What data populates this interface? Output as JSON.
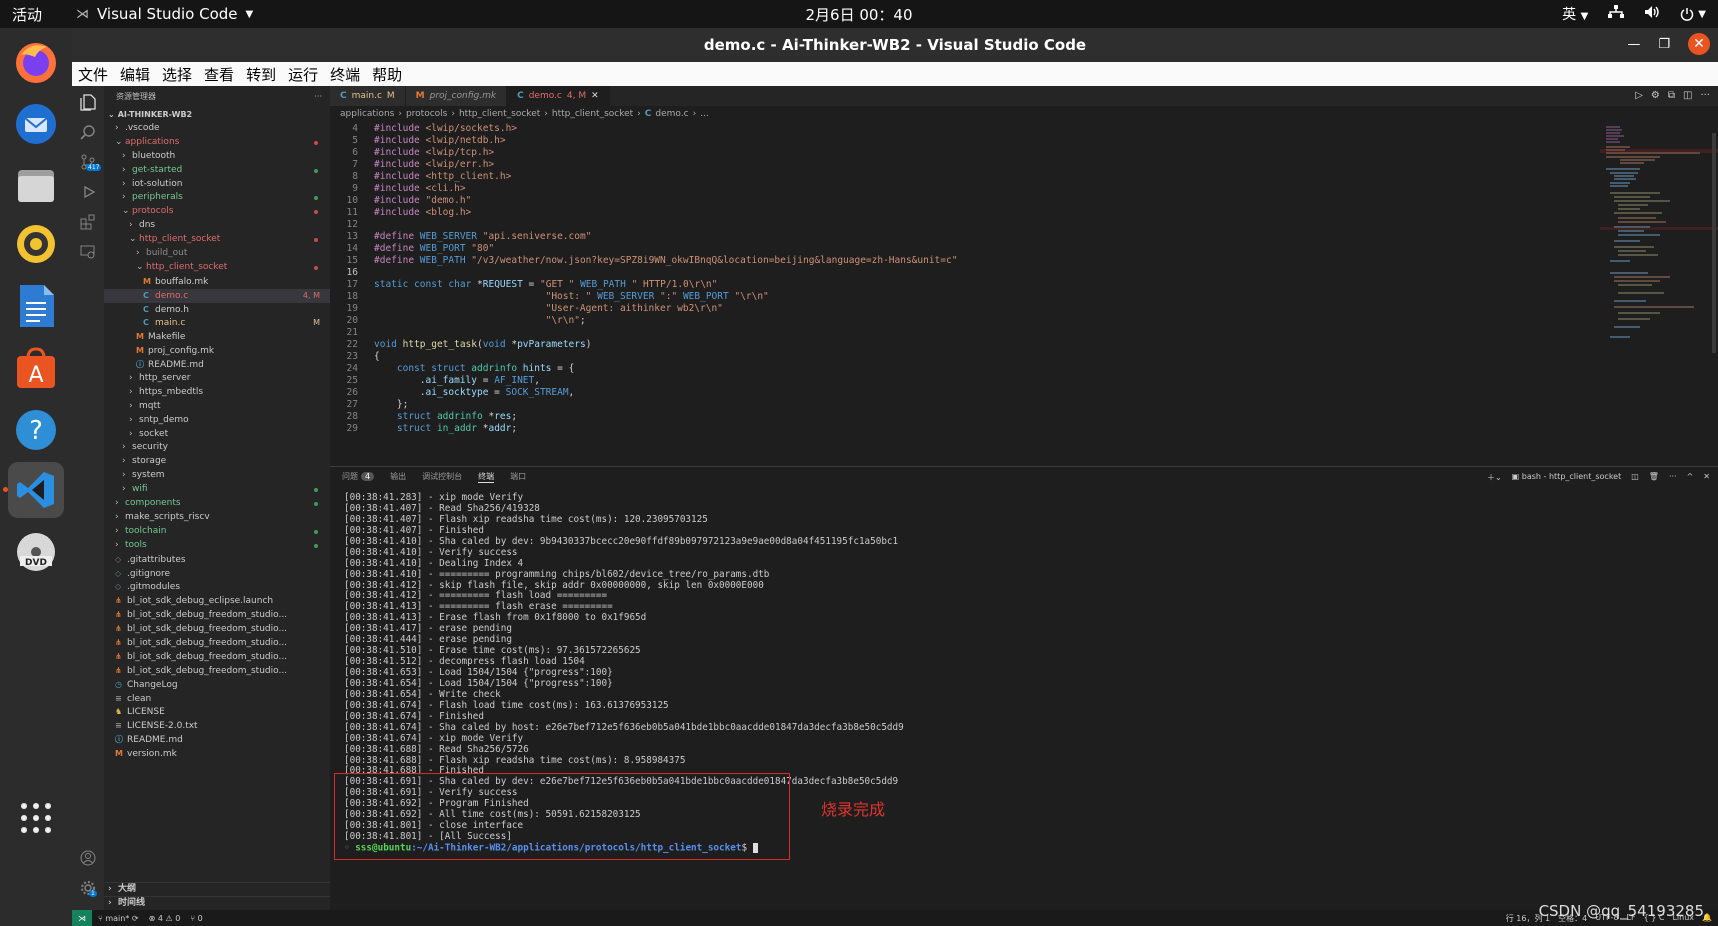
{
  "topbar": {
    "activities": "活动",
    "app_name": "Visual Studio Code",
    "clock": "2月6日  00：40",
    "ime": "英"
  },
  "window": {
    "title": "demo.c - Ai-Thinker-WB2 - Visual Studio Code"
  },
  "menu": [
    "文件",
    "编辑",
    "选择",
    "查看",
    "转到",
    "运行",
    "终端",
    "帮助"
  ],
  "dock": [
    "firefox-icon",
    "thunderbird-icon",
    "files-icon",
    "rhythmbox-icon",
    "writer-icon",
    "app-center-icon",
    "help-icon",
    "vscode-icon",
    "dvd-icon",
    "show-apps-icon"
  ],
  "activity_bar": {
    "scm_badge": "417",
    "settings_badge": "1"
  },
  "sidebar": {
    "header": "资源管理器",
    "root": "AI-THINKER-WB2",
    "tree": [
      {
        "d": 1,
        "k": "folder",
        "label": ".vscode",
        "open": false
      },
      {
        "d": 1,
        "k": "folder",
        "label": "applications",
        "open": true,
        "color": "#e06c6c",
        "dot": "#c74b4b"
      },
      {
        "d": 2,
        "k": "folder",
        "label": "bluetooth",
        "open": false
      },
      {
        "d": 2,
        "k": "folder",
        "label": "get-started",
        "open": false,
        "color": "#73c991",
        "dot": "#3f9b5a"
      },
      {
        "d": 2,
        "k": "folder",
        "label": "iot-solution",
        "open": false
      },
      {
        "d": 2,
        "k": "folder",
        "label": "peripherals",
        "open": false,
        "color": "#73c991",
        "dot": "#3f9b5a"
      },
      {
        "d": 2,
        "k": "folder",
        "label": "protocols",
        "open": true,
        "color": "#e06c6c",
        "dot": "#c74b4b"
      },
      {
        "d": 3,
        "k": "folder",
        "label": "dns",
        "open": false
      },
      {
        "d": 3,
        "k": "folder",
        "label": "http_client_socket",
        "open": true,
        "color": "#e06c6c",
        "dot": "#c74b4b"
      },
      {
        "d": 4,
        "k": "folder",
        "label": "build_out",
        "open": false,
        "color": "#8c8c8c"
      },
      {
        "d": 4,
        "k": "folder",
        "label": "http_client_socket",
        "open": true,
        "color": "#e06c6c",
        "dot": "#c74b4b"
      },
      {
        "d": 5,
        "k": "M",
        "label": "bouffalo.mk"
      },
      {
        "d": 5,
        "k": "C",
        "label": "demo.c",
        "color": "#e06c6c",
        "status": "4, M",
        "sel": true
      },
      {
        "d": 5,
        "k": "C",
        "label": "demo.h"
      },
      {
        "d": 5,
        "k": "C",
        "label": "main.c",
        "color": "#e2c08d",
        "status": "M"
      },
      {
        "d": 4,
        "k": "M",
        "label": "Makefile"
      },
      {
        "d": 4,
        "k": "M",
        "label": "proj_config.mk"
      },
      {
        "d": 4,
        "k": "i",
        "label": "README.md"
      },
      {
        "d": 3,
        "k": "folder",
        "label": "http_server",
        "open": false
      },
      {
        "d": 3,
        "k": "folder",
        "label": "https_mbedtls",
        "open": false
      },
      {
        "d": 3,
        "k": "folder",
        "label": "mqtt",
        "open": false
      },
      {
        "d": 3,
        "k": "folder",
        "label": "sntp_demo",
        "open": false
      },
      {
        "d": 3,
        "k": "folder",
        "label": "socket",
        "open": false
      },
      {
        "d": 2,
        "k": "folder",
        "label": "security",
        "open": false
      },
      {
        "d": 2,
        "k": "folder",
        "label": "storage",
        "open": false
      },
      {
        "d": 2,
        "k": "folder",
        "label": "system",
        "open": false
      },
      {
        "d": 2,
        "k": "folder",
        "label": "wifi",
        "open": false,
        "color": "#73c991",
        "dot": "#3f9b5a"
      },
      {
        "d": 1,
        "k": "folder",
        "label": "components",
        "open": false,
        "color": "#73c991",
        "dot": "#3f9b5a"
      },
      {
        "d": 1,
        "k": "folder",
        "label": "make_scripts_riscv",
        "open": false
      },
      {
        "d": 1,
        "k": "folder",
        "label": "toolchain",
        "open": false,
        "color": "#73c991",
        "dot": "#3f9b5a"
      },
      {
        "d": 1,
        "k": "folder",
        "label": "tools",
        "open": false,
        "color": "#73c991",
        "dot": "#3f9b5a"
      },
      {
        "d": 1,
        "k": "g",
        "label": ".gitattributes"
      },
      {
        "d": 1,
        "k": "g",
        "label": ".gitignore"
      },
      {
        "d": 1,
        "k": "g",
        "label": ".gitmodules"
      },
      {
        "d": 1,
        "k": "x",
        "label": "bl_iot_sdk_debug_eclipse.launch"
      },
      {
        "d": 1,
        "k": "x",
        "label": "bl_iot_sdk_debug_freedom_studio..."
      },
      {
        "d": 1,
        "k": "x",
        "label": "bl_iot_sdk_debug_freedom_studio..."
      },
      {
        "d": 1,
        "k": "x",
        "label": "bl_iot_sdk_debug_freedom_studio..."
      },
      {
        "d": 1,
        "k": "x",
        "label": "bl_iot_sdk_debug_freedom_studio..."
      },
      {
        "d": 1,
        "k": "x",
        "label": "bl_iot_sdk_debug_freedom_studio..."
      },
      {
        "d": 1,
        "k": "h",
        "label": "ChangeLog"
      },
      {
        "d": 1,
        "k": "e",
        "label": "clean"
      },
      {
        "d": 1,
        "k": "l",
        "label": "LICENSE"
      },
      {
        "d": 1,
        "k": "e",
        "label": "LICENSE-2.0.txt"
      },
      {
        "d": 1,
        "k": "i",
        "label": "README.md"
      },
      {
        "d": 1,
        "k": "M",
        "label": "version.mk"
      }
    ],
    "outline": "大纲",
    "timeline": "时间线"
  },
  "tabs": [
    {
      "label": "main.c",
      "flag": "M",
      "active": false,
      "italic": false
    },
    {
      "label": "proj_config.mk",
      "flag": "",
      "active": false,
      "italic": true
    },
    {
      "label": "demo.c",
      "flag": "4, M",
      "active": true,
      "italic": false
    }
  ],
  "breadcrumb": [
    "applications",
    "protocols",
    "http_client_socket",
    "http_client_socket",
    "demo.c",
    "..."
  ],
  "code_lines": [
    {
      "n": "4",
      "html": "<span class='pp'>#include</span> <span class='str'>&lt;lwip/sockets.h&gt;</span>"
    },
    {
      "n": "5",
      "html": "<span class='pp'>#include</span> <span class='str'>&lt;lwip/netdb.h&gt;</span>"
    },
    {
      "n": "6",
      "html": "<span class='pp'>#include</span> <span class='str'>&lt;lwip/tcp.h&gt;</span>"
    },
    {
      "n": "7",
      "html": "<span class='pp'>#include</span> <span class='str'>&lt;lwip/err.h&gt;</span>"
    },
    {
      "n": "8",
      "html": "<span class='pp'>#include</span> <span class='str'>&lt;http_client.h&gt;</span>"
    },
    {
      "n": "9",
      "html": "<span class='pp'>#include</span> <span class='str'>&lt;cli.h&gt;</span>"
    },
    {
      "n": "10",
      "html": "<span class='pp'>#include</span> <span class='str'>\"demo.h\"</span>"
    },
    {
      "n": "11",
      "html": "<span class='pp'>#include</span> <span class='str'>&lt;blog.h&gt;</span>"
    },
    {
      "n": "12",
      "html": ""
    },
    {
      "n": "13",
      "html": "<span class='pp'>#define</span> <span class='mac'>WEB_SERVER</span> <span class='str'>\"api.seniverse.com\"</span>"
    },
    {
      "n": "14",
      "html": "<span class='pp'>#define</span> <span class='mac'>WEB_PORT</span> <span class='str'>\"80\"</span>"
    },
    {
      "n": "15",
      "html": "<span class='pp'>#define</span> <span class='mac'>WEB_PATH</span> <span class='str'>\"/v3/weather/now.json?key=SPZ8i9WN_okwIBnqQ&amp;location=beijing&amp;language=zh-Hans&amp;unit=c\"</span>"
    },
    {
      "n": "16",
      "html": "",
      "cur": true
    },
    {
      "n": "17",
      "html": "<span class='kw'>static</span> <span class='kw'>const</span> <span class='kw'>char</span> <span class='pl'>*</span><span class='var'>REQUEST</span> <span class='pl'>=</span> <span class='str'>\"GET \"</span> <span class='mac'>WEB_PATH</span> <span class='str'>\" HTTP/1.0\\r\\n\"</span>"
    },
    {
      "n": "18",
      "html": "                              <span class='str'>\"Host: \"</span> <span class='mac'>WEB_SERVER</span> <span class='str'>\":\"</span> <span class='mac'>WEB_PORT</span> <span class='str'>\"\\r\\n\"</span>"
    },
    {
      "n": "19",
      "html": "                              <span class='str'>\"User-Agent: aithinker wb2\\r\\n\"</span>"
    },
    {
      "n": "20",
      "html": "                              <span class='str'>\"\\r\\n\"</span><span class='pl'>;</span>"
    },
    {
      "n": "21",
      "html": ""
    },
    {
      "n": "22",
      "html": "<span class='kw'>void</span> <span class='fn'>http_get_task</span><span class='pl'>(</span><span class='kw'>void</span> <span class='pl'>*</span><span class='var'>pvParameters</span><span class='pl'>)</span>"
    },
    {
      "n": "23",
      "html": "<span class='pl'>{</span>"
    },
    {
      "n": "24",
      "html": "    <span class='kw'>const</span> <span class='kw'>struct</span> <span class='ty'>addrinfo</span> <span class='var'>hints</span> <span class='pl'>= {</span>"
    },
    {
      "n": "25",
      "html": "        <span class='pl'>.</span><span class='var'>ai_family</span> <span class='pl'>=</span> <span class='mac'>AF_INET</span><span class='pl'>,</span>"
    },
    {
      "n": "26",
      "html": "        <span class='pl'>.</span><span class='var'>ai_socktype</span> <span class='pl'>=</span> <span class='mac'>SOCK_STREAM</span><span class='pl'>,</span>"
    },
    {
      "n": "27",
      "html": "    <span class='pl'>};</span>"
    },
    {
      "n": "28",
      "html": "    <span class='kw'>struct</span> <span class='ty'>addrinfo</span> <span class='pl'>*</span><span class='var'>res</span><span class='pl'>;</span>"
    },
    {
      "n": "29",
      "html": "    <span class='kw'>struct</span> <span class='ty'>in_addr</span> <span class='pl'>*</span><span class='var'>addr</span><span class='pl'>;</span>"
    }
  ],
  "panel": {
    "tabs": [
      {
        "label": "问题",
        "badge": "4"
      },
      {
        "label": "输出"
      },
      {
        "label": "调试控制台"
      },
      {
        "label": "终端",
        "active": true
      },
      {
        "label": "端口"
      }
    ],
    "terminal_name": "bash - http_client_socket"
  },
  "terminal_lines": [
    "[00:38:41.283] - xip mode Verify",
    "[00:38:41.407] - Read Sha256/419328",
    "[00:38:41.407] - Flash xip readsha time cost(ms): 120.23095703125",
    "[00:38:41.407] - Finished",
    "[00:38:41.410] - Sha caled by dev: 9b9430337bcecc20e90ffdf89b097972123a9e9ae00d8a04f451195fc1a50bc1",
    "[00:38:41.410] - Verify success",
    "[00:38:41.410] - Dealing Index 4",
    "[00:38:41.410] - ========= programming chips/bl602/device_tree/ro_params.dtb",
    "[00:38:41.412] - skip flash file, skip addr 0x00000000, skip len 0x0000E000",
    "[00:38:41.412] - ========= flash load =========",
    "[00:38:41.413] - ========= flash erase =========",
    "[00:38:41.413] - Erase flash from 0x1f8000 to 0x1f965d",
    "[00:38:41.417] - erase pending",
    "[00:38:41.444] - erase pending",
    "[00:38:41.510] - Erase time cost(ms): 97.361572265625",
    "[00:38:41.512] - decompress flash load 1504",
    "[00:38:41.653] - Load 1504/1504 {\"progress\":100}",
    "[00:38:41.654] - Load 1504/1504 {\"progress\":100}",
    "[00:38:41.654] - Write check",
    "[00:38:41.674] - Flash load time cost(ms): 163.61376953125",
    "[00:38:41.674] - Finished",
    "[00:38:41.674] - Sha caled by host: e26e7bef712e5f636eb0b5a041bde1bbc0aacdde01847da3decfa3b8e50c5dd9",
    "[00:38:41.674] - xip mode Verify",
    "[00:38:41.688] - Read Sha256/5726",
    "[00:38:41.688] - Flash xip readsha time cost(ms): 8.958984375",
    "[00:38:41.688] - Finished",
    "[00:38:41.691] - Sha caled by dev: e26e7bef712e5f636eb0b5a041bde1bbc0aacdde01847da3decfa3b8e50c5dd9",
    "[00:38:41.691] - Verify success",
    "[00:38:41.692] - Program Finished",
    "[00:38:41.692] - All time cost(ms): 50591.62158203125",
    "[00:38:41.801] - close interface",
    "[00:38:41.801] - [All Success]"
  ],
  "prompt": {
    "user": "sss@ubuntu",
    "path": ":~/Ai-Thinker-WB2/applications/protocols/http_client_socket",
    "suffix": "$ "
  },
  "annotation": "烧录完成",
  "status": {
    "branch": "main*",
    "errors": "⊗ 4 ⚠ 0",
    "ports": "⑂ 0",
    "position": "行 16，列 1",
    "spaces": "空格：4",
    "encoding": "UTF-8",
    "eol": "LF",
    "lang": "{ } C",
    "platform": "Linux"
  },
  "watermark": "CSDN @qq_54193285"
}
